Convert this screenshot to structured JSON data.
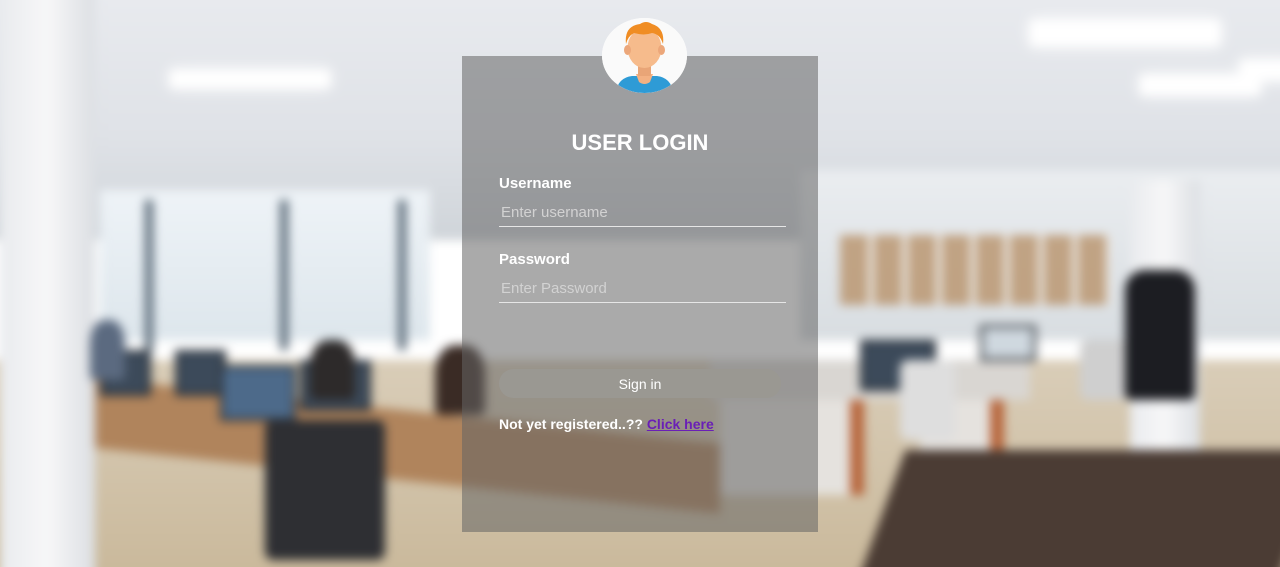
{
  "login": {
    "title": "USER LOGIN",
    "username_label": "Username",
    "username_placeholder": "Enter username",
    "username_value": "",
    "password_label": "Password",
    "password_placeholder": "Enter Password",
    "password_value": "",
    "signin_label": "Sign in",
    "register_text": "Not yet registered..??",
    "register_link": "Click here"
  },
  "icons": {
    "avatar": "user-avatar-icon"
  },
  "colors": {
    "panel": "#646464",
    "button": "#9a9892",
    "link": "#6a1fb6",
    "avatar_hair": "#f08d24",
    "avatar_shirt": "#2e9bd6"
  }
}
